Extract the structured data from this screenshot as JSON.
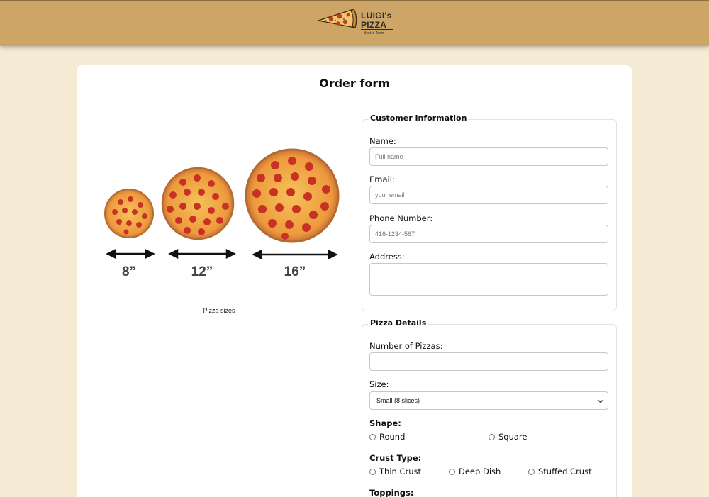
{
  "header": {
    "logo": {
      "line1": "LUIGI's",
      "line2": "PIZZA",
      "tagline": "Best in Town"
    }
  },
  "main": {
    "title": "Order form",
    "figure": {
      "sizes": [
        {
          "label": "8”"
        },
        {
          "label": "12”"
        },
        {
          "label": "16”"
        }
      ],
      "caption": "Pizza sizes"
    }
  },
  "customer": {
    "legend": "Customer Information",
    "name": {
      "label": "Name:",
      "placeholder": "Full name",
      "value": ""
    },
    "email": {
      "label": "Email:",
      "placeholder": "your email",
      "value": ""
    },
    "phone": {
      "label": "Phone Number:",
      "placeholder": "416-1234-567",
      "value": ""
    },
    "address": {
      "label": "Address:",
      "value": ""
    }
  },
  "pizza": {
    "legend": "Pizza Details",
    "count": {
      "label": "Number of Pizzas:",
      "value": ""
    },
    "size": {
      "label": "Size:",
      "selected": "Small (8 slices)"
    },
    "shape": {
      "label": "Shape:",
      "options": [
        "Round",
        "Square"
      ]
    },
    "crust": {
      "label": "Crust Type:",
      "options": [
        "Thin Crust",
        "Deep Dish",
        "Stuffed Crust"
      ]
    },
    "toppings": {
      "label": "Toppings:"
    }
  },
  "colors": {
    "header_bg": "#cda566",
    "page_bg": "#f5ead4",
    "card_bg": "#ffffff"
  }
}
